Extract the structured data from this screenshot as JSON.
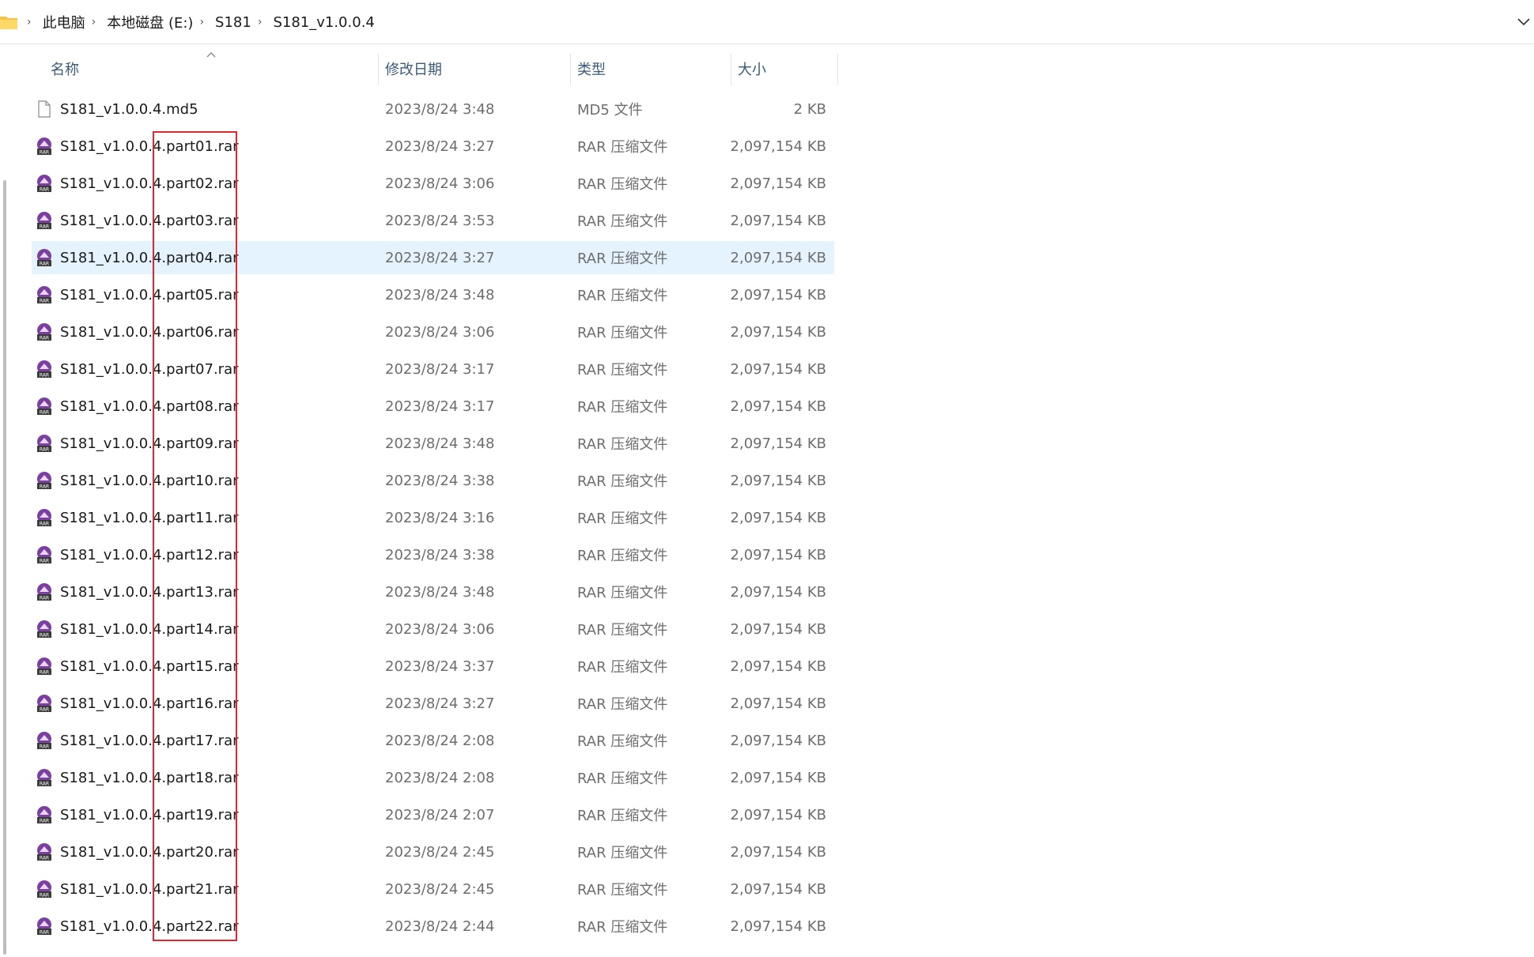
{
  "address": {
    "breadcrumbs": [
      "此电脑",
      "本地磁盘 (E:)",
      "S181",
      "S181_v1.0.0.4"
    ]
  },
  "columns": {
    "name": "名称",
    "date": "修改日期",
    "type": "类型",
    "size": "大小"
  },
  "files": [
    {
      "name": "S181_v1.0.0.4.md5",
      "date": "2023/8/24 3:48",
      "type": "MD5 文件",
      "size": "2 KB",
      "icon": "file-icon"
    },
    {
      "name": "S181_v1.0.0.4.part01.rar",
      "date": "2023/8/24 3:27",
      "type": "RAR 压缩文件",
      "size": "2,097,154 KB",
      "icon": "rar-icon"
    },
    {
      "name": "S181_v1.0.0.4.part02.rar",
      "date": "2023/8/24 3:06",
      "type": "RAR 压缩文件",
      "size": "2,097,154 KB",
      "icon": "rar-icon"
    },
    {
      "name": "S181_v1.0.0.4.part03.rar",
      "date": "2023/8/24 3:53",
      "type": "RAR 压缩文件",
      "size": "2,097,154 KB",
      "icon": "rar-icon"
    },
    {
      "name": "S181_v1.0.0.4.part04.rar",
      "date": "2023/8/24 3:27",
      "type": "RAR 压缩文件",
      "size": "2,097,154 KB",
      "icon": "rar-icon",
      "selected": true
    },
    {
      "name": "S181_v1.0.0.4.part05.rar",
      "date": "2023/8/24 3:48",
      "type": "RAR 压缩文件",
      "size": "2,097,154 KB",
      "icon": "rar-icon"
    },
    {
      "name": "S181_v1.0.0.4.part06.rar",
      "date": "2023/8/24 3:06",
      "type": "RAR 压缩文件",
      "size": "2,097,154 KB",
      "icon": "rar-icon"
    },
    {
      "name": "S181_v1.0.0.4.part07.rar",
      "date": "2023/8/24 3:17",
      "type": "RAR 压缩文件",
      "size": "2,097,154 KB",
      "icon": "rar-icon"
    },
    {
      "name": "S181_v1.0.0.4.part08.rar",
      "date": "2023/8/24 3:17",
      "type": "RAR 压缩文件",
      "size": "2,097,154 KB",
      "icon": "rar-icon"
    },
    {
      "name": "S181_v1.0.0.4.part09.rar",
      "date": "2023/8/24 3:48",
      "type": "RAR 压缩文件",
      "size": "2,097,154 KB",
      "icon": "rar-icon"
    },
    {
      "name": "S181_v1.0.0.4.part10.rar",
      "date": "2023/8/24 3:38",
      "type": "RAR 压缩文件",
      "size": "2,097,154 KB",
      "icon": "rar-icon"
    },
    {
      "name": "S181_v1.0.0.4.part11.rar",
      "date": "2023/8/24 3:16",
      "type": "RAR 压缩文件",
      "size": "2,097,154 KB",
      "icon": "rar-icon"
    },
    {
      "name": "S181_v1.0.0.4.part12.rar",
      "date": "2023/8/24 3:38",
      "type": "RAR 压缩文件",
      "size": "2,097,154 KB",
      "icon": "rar-icon"
    },
    {
      "name": "S181_v1.0.0.4.part13.rar",
      "date": "2023/8/24 3:48",
      "type": "RAR 压缩文件",
      "size": "2,097,154 KB",
      "icon": "rar-icon"
    },
    {
      "name": "S181_v1.0.0.4.part14.rar",
      "date": "2023/8/24 3:06",
      "type": "RAR 压缩文件",
      "size": "2,097,154 KB",
      "icon": "rar-icon"
    },
    {
      "name": "S181_v1.0.0.4.part15.rar",
      "date": "2023/8/24 3:37",
      "type": "RAR 压缩文件",
      "size": "2,097,154 KB",
      "icon": "rar-icon"
    },
    {
      "name": "S181_v1.0.0.4.part16.rar",
      "date": "2023/8/24 3:27",
      "type": "RAR 压缩文件",
      "size": "2,097,154 KB",
      "icon": "rar-icon"
    },
    {
      "name": "S181_v1.0.0.4.part17.rar",
      "date": "2023/8/24 2:08",
      "type": "RAR 压缩文件",
      "size": "2,097,154 KB",
      "icon": "rar-icon"
    },
    {
      "name": "S181_v1.0.0.4.part18.rar",
      "date": "2023/8/24 2:08",
      "type": "RAR 压缩文件",
      "size": "2,097,154 KB",
      "icon": "rar-icon"
    },
    {
      "name": "S181_v1.0.0.4.part19.rar",
      "date": "2023/8/24 2:07",
      "type": "RAR 压缩文件",
      "size": "2,097,154 KB",
      "icon": "rar-icon"
    },
    {
      "name": "S181_v1.0.0.4.part20.rar",
      "date": "2023/8/24 2:45",
      "type": "RAR 压缩文件",
      "size": "2,097,154 KB",
      "icon": "rar-icon"
    },
    {
      "name": "S181_v1.0.0.4.part21.rar",
      "date": "2023/8/24 2:45",
      "type": "RAR 压缩文件",
      "size": "2,097,154 KB",
      "icon": "rar-icon"
    },
    {
      "name": "S181_v1.0.0.4.part22.rar",
      "date": "2023/8/24 2:44",
      "type": "RAR 压缩文件",
      "size": "2,097,154 KB",
      "icon": "rar-icon"
    }
  ],
  "colors": {
    "selected_row": "#e5f3ff",
    "highlight_box": "#e0272d",
    "header_text": "#3b5a7a",
    "rar_icon": "#7b3fa0"
  }
}
